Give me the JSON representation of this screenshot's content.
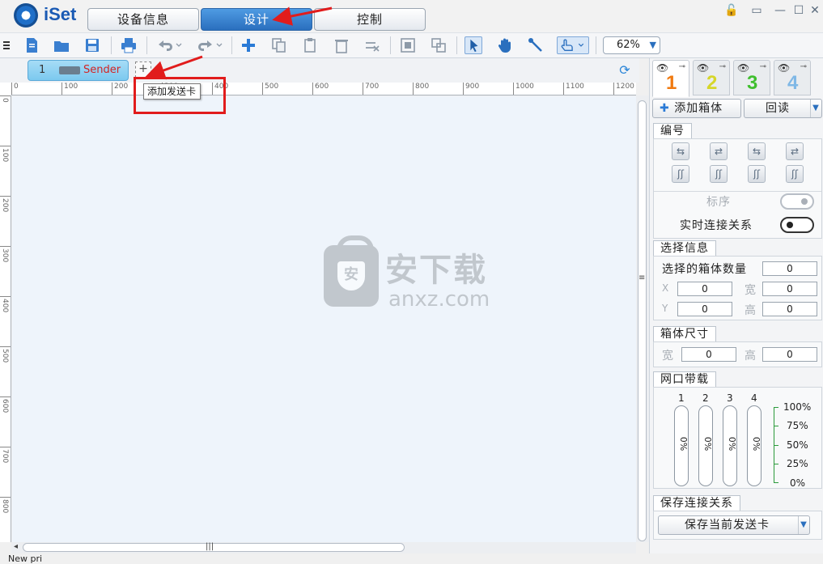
{
  "app": {
    "name": "iSet"
  },
  "top_tabs": [
    {
      "label": "设备信息"
    },
    {
      "label": "设计"
    },
    {
      "label": "控制"
    }
  ],
  "toolbar": {
    "zoom": "62%"
  },
  "sender_tab": {
    "number": "1",
    "name": "Sender 1",
    "add_tooltip": "添加发送卡"
  },
  "ruler": {
    "h": [
      "0",
      "100",
      "200",
      "300",
      "400",
      "500",
      "600",
      "700",
      "800",
      "900",
      "1000",
      "1100",
      "1200"
    ],
    "v": [
      "0",
      "100",
      "200",
      "300",
      "400",
      "500",
      "600",
      "700",
      "800"
    ]
  },
  "watermark": {
    "text": "安下载",
    "url": "anxz.com",
    "badge": "安"
  },
  "layer_tabs": [
    {
      "number": "1",
      "color": "#f07a10"
    },
    {
      "number": "2",
      "color": "#d6d62a"
    },
    {
      "number": "3",
      "color": "#3fbf2e"
    },
    {
      "number": "4",
      "color": "#7fb8e6"
    }
  ],
  "panel": {
    "add_box": "添加箱体",
    "readback": "回读",
    "numbering": {
      "title": "编号",
      "label_order": "标序",
      "label_realtime": "实时连接关系"
    },
    "selection": {
      "title": "选择信息",
      "count_label": "选择的箱体数量",
      "count": "0",
      "x_label": "X",
      "x": "0",
      "w_label": "宽",
      "w": "0",
      "y_label": "Y",
      "y": "0",
      "h_label": "高",
      "h": "0"
    },
    "box_size": {
      "title": "箱体尺寸",
      "w_label": "宽",
      "w": "0",
      "h_label": "高",
      "h": "0"
    },
    "bandwidth": {
      "title": "网口带载",
      "ports": [
        "1",
        "2",
        "3",
        "4"
      ],
      "values": [
        "0%",
        "0%",
        "0%",
        "0%"
      ],
      "scale": [
        "100%",
        "75%",
        "50%",
        "25%",
        "0%"
      ]
    },
    "save": {
      "title": "保存连接关系",
      "button": "保存当前发送卡"
    }
  },
  "status": {
    "text": "New pri"
  }
}
